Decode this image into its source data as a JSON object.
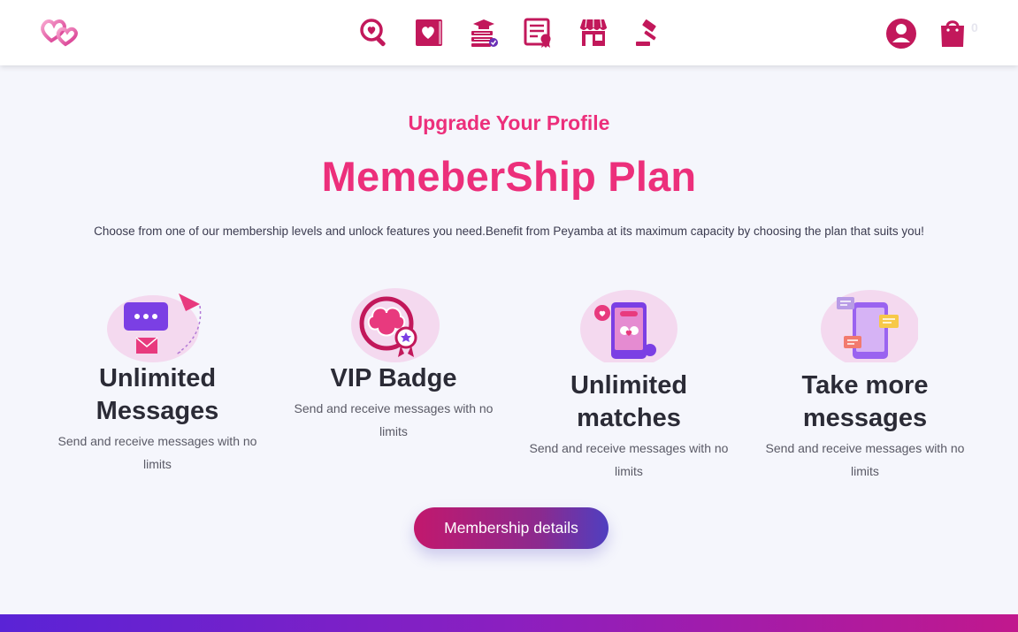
{
  "header": {
    "nav_icons": [
      "search-heart-icon",
      "heart-book-icon",
      "graduation-books-icon",
      "certificate-icon",
      "store-icon",
      "auction-gavel-icon"
    ],
    "cart_count": "0"
  },
  "hero": {
    "subtitle": "Upgrade Your Profile",
    "title": "MemeberShip Plan",
    "description": "Choose from one of our membership levels and unlock features you need.Benefit from Peyamba at its maximum capacity by choosing the plan that suits you!"
  },
  "features": [
    {
      "title_line1": "Unlimited",
      "title_line2": "Messages",
      "desc": "Send and receive messages with no limits"
    },
    {
      "title_line1": "VIP Badge",
      "title_line2": "",
      "desc": "Send and receive messages with no limits"
    },
    {
      "title_line1": "Unlimited",
      "title_line2": "matches",
      "desc": "Send and receive messages with no limits"
    },
    {
      "title_line1": "Take more",
      "title_line2": "messages",
      "desc": "Send and receive messages with no limits"
    }
  ],
  "cta": {
    "label": "Membership details"
  },
  "colors": {
    "accent": "#ec2f7b",
    "icon": "#c2185b",
    "purple": "#7b3fe4"
  }
}
